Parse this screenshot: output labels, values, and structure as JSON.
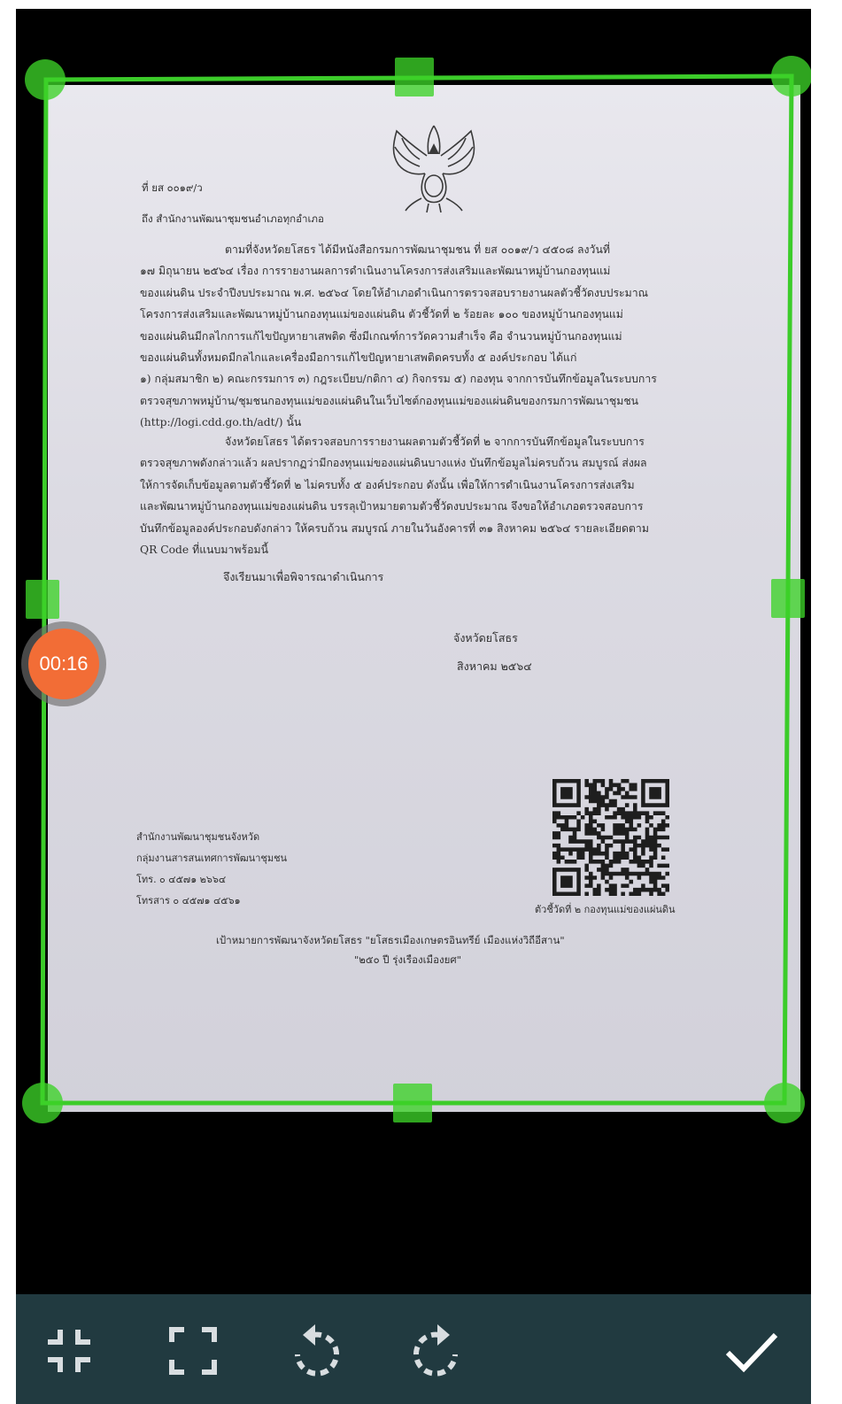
{
  "document": {
    "ref": "ที่ ยส ๐๐๑๙/ว",
    "to": "ถึง สำนักงานพัฒนาชุมชนอำเภอทุกอำเภอ",
    "paragraph1": [
      "ตามที่จังหวัดยโสธร ได้มีหนังสือกรมการพัฒนาชุมชน ที่ ยส ๐๐๑๙/ว ๔๕๐๘ ลงวันที่",
      "๑๗ มิถุนายน ๒๕๖๔ เรื่อง การรายงานผลการดำเนินงานโครงการส่งเสริมและพัฒนาหมู่บ้านกองทุนแม่",
      "ของแผ่นดิน ประจำปีงบประมาณ พ.ศ. ๒๕๖๔ โดยให้อำเภอดำเนินการตรวจสอบรายงานผลตัวชี้วัดงบประมาณ",
      "โครงการส่งเสริมและพัฒนาหมู่บ้านกองทุนแม่ของแผ่นดิน ตัวชี้วัดที่ ๒ ร้อยละ ๑๐๐ ของหมู่บ้านกองทุนแม่",
      "ของแผ่นดินมีกลไกการแก้ไขปัญหายาเสพติด ซึ่งมีเกณฑ์การวัดความสำเร็จ คือ จำนวนหมู่บ้านกองทุนแม่",
      "ของแผ่นดินทั้งหมดมีกลไกและเครื่องมือการแก้ไขปัญหายาเสพติดครบทั้ง ๕ องค์ประกอบ ได้แก่",
      "๑) กลุ่มสมาชิก ๒) คณะกรรมการ ๓) กฎระเบียบ/กติกา ๔) กิจกรรม ๕) กองทุน จากการบันทึกข้อมูลในระบบการ",
      "ตรวจสุขภาพหมู่บ้าน/ชุมชนกองทุนแม่ของแผ่นดินในเว็บไซต์กองทุนแม่ของแผ่นดินของกรมการพัฒนาชุมชน",
      "(http://logi.cdd.go.th/adt/) นั้น"
    ],
    "paragraph2": [
      "จังหวัดยโสธร ได้ตรวจสอบการรายงานผลตามตัวชี้วัดที่ ๒ จากการบันทึกข้อมูลในระบบการ",
      "ตรวจสุขภาพดังกล่าวแล้ว ผลปรากฏว่ามีกองทุนแม่ของแผ่นดินบางแห่ง บันทึกข้อมูลไม่ครบถ้วน สมบูรณ์ ส่งผล",
      "ให้การจัดเก็บข้อมูลตามตัวชี้วัดที่ ๒ ไม่ครบทั้ง ๕ องค์ประกอบ ดังนั้น เพื่อให้การดำเนินงานโครงการส่งเสริม",
      "และพัฒนาหมู่บ้านกองทุนแม่ของแผ่นดิน บรรลุเป้าหมายตามตัวชี้วัดงบประมาณ จึงขอให้อำเภอตรวจสอบการ",
      "บันทึกข้อมูลองค์ประกอบดังกล่าว ให้ครบถ้วน สมบูรณ์ ภายในวันอังคารที่ ๓๑ สิงหาคม ๒๕๖๔ รายละเอียดตาม",
      "QR Code ที่แนบมาพร้อมนี้"
    ],
    "closing": "จึงเรียนมาเพื่อพิจารณาดำเนินการ",
    "signature_org": "จังหวัดยโสธร",
    "date": "สิงหาคม ๒๕๖๔",
    "footer_office": [
      "สำนักงานพัฒนาชุมชนจังหวัด",
      "กลุ่มงานสารสนเทศการพัฒนาชุมชน",
      "โทร. ๐ ๔๕๗๑ ๒๖๖๔",
      "โทรสาร ๐ ๔๕๗๑ ๔๕๖๑"
    ],
    "qr_caption": "ตัวชี้วัดที่ ๒ กองทุนแม่ของแผ่นดิน",
    "slogan": [
      "เป้าหมายการพัฒนาจังหวัดยโสธร \"ยโสธรเมืองเกษตรอินทรีย์ เมืองแห่งวิถีอีสาน\"",
      "\"๒๕๐ ปี รุ่งเรืองเมืองยศ\""
    ]
  },
  "recording": {
    "timer": "00:16"
  },
  "toolbar": {
    "items": [
      {
        "name": "shrink-icon"
      },
      {
        "name": "expand-icon"
      },
      {
        "name": "rotate-left-icon"
      },
      {
        "name": "rotate-right-icon"
      },
      {
        "name": "confirm-check-icon"
      }
    ]
  },
  "colors": {
    "crop": "#3ccc2a",
    "timer": "#f26d36",
    "toolbar": "#213a40",
    "backdrop": "#000000"
  }
}
